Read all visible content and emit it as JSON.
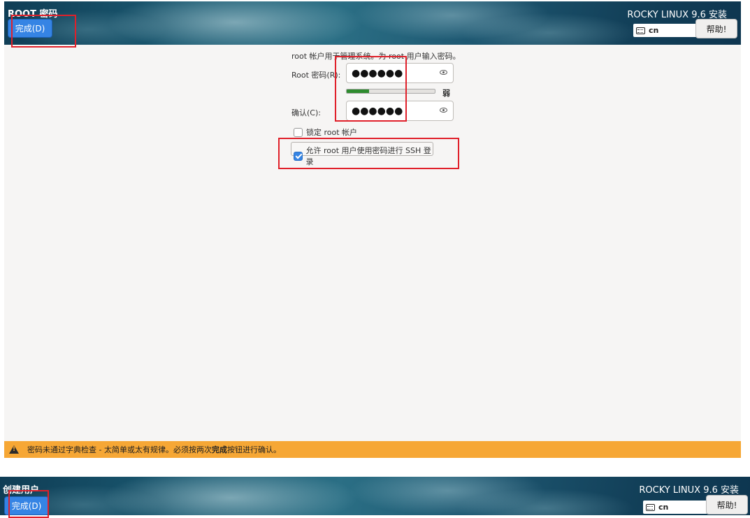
{
  "window1": {
    "spoke_title": "ROOT 密码",
    "done_label": "完成(D)",
    "product_title": "ROCKY LINUX 9.6 安装",
    "keyboard_layout": "cn",
    "help_label": "帮助!",
    "description": "root 帐户用于管理系统。为 root 用户输入密码。",
    "password_label": "Root 密码(R):",
    "password_value": "●●●●●●",
    "confirm_label": "确认(C):",
    "confirm_value": "●●●●●●",
    "strength_label": "弱",
    "strength_fraction": 0.25,
    "lock_root_label": "锁定 root 帐户",
    "lock_root_checked": false,
    "allow_ssh_label": "允许 root 用户使用密码进行 SSH 登录",
    "allow_ssh_checked": true,
    "warning_prefix": "密码未通过字典检查 - 太简单或太有规律。必须按两次",
    "warning_bold": "完成",
    "warning_suffix": "按钮进行确认。"
  },
  "window2": {
    "spoke_title": "创建用户",
    "done_label": "完成(D)",
    "product_title": "ROCKY LINUX 9.6 安装",
    "keyboard_layout": "cn",
    "help_label": "帮助!"
  },
  "colors": {
    "accent": "#3584e4",
    "warning_bar": "#f6a735",
    "highlight": "#e0202a",
    "strength_fill": "#2e8b2e"
  }
}
